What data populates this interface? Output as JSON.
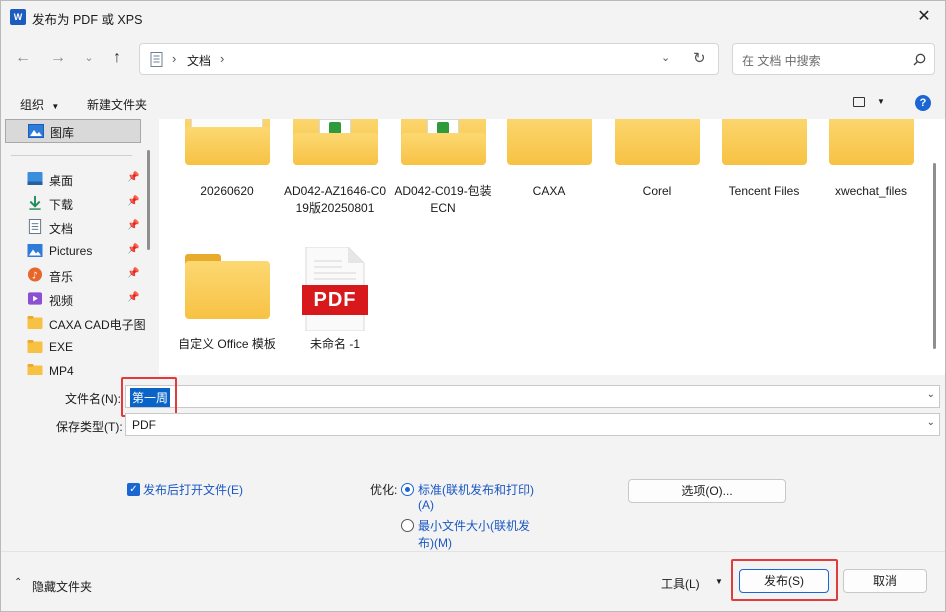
{
  "window": {
    "title": "发布为 PDF 或 XPS",
    "app_icon_letter": "W"
  },
  "address": {
    "path_root_icon": "document-icon",
    "path": [
      "文档"
    ],
    "search_placeholder": "在 文档 中搜索"
  },
  "toolbar": {
    "organize_label": "组织",
    "new_folder_label": "新建文件夹"
  },
  "sidebar": {
    "items": [
      {
        "label": "图库",
        "icon": "gallery-icon",
        "pinned": false
      },
      {
        "label": "桌面",
        "icon": "desktop-icon",
        "pinned": true
      },
      {
        "label": "下载",
        "icon": "download-icon",
        "pinned": true
      },
      {
        "label": "文档",
        "icon": "document-icon",
        "pinned": true
      },
      {
        "label": "Pictures",
        "icon": "pictures-icon",
        "pinned": true
      },
      {
        "label": "音乐",
        "icon": "music-icon",
        "pinned": true
      },
      {
        "label": "视频",
        "icon": "video-icon",
        "pinned": true
      },
      {
        "label": "CAXA CAD电子图",
        "icon": "folder-icon",
        "pinned": false
      },
      {
        "label": "EXE",
        "icon": "folder-icon",
        "pinned": false
      },
      {
        "label": "MP4",
        "icon": "folder-icon",
        "pinned": false
      }
    ]
  },
  "files": [
    {
      "name": "20260620",
      "type": "folder"
    },
    {
      "name": "AD042-AZ1646-C019版20250801",
      "type": "folder"
    },
    {
      "name": "AD042-C019-包装ECN",
      "type": "folder"
    },
    {
      "name": "CAXA",
      "type": "folder"
    },
    {
      "name": "Corel",
      "type": "folder"
    },
    {
      "name": "Tencent Files",
      "type": "folder"
    },
    {
      "name": "xwechat_files",
      "type": "folder"
    },
    {
      "name": "自定义 Office 模板",
      "type": "folder"
    },
    {
      "name": "未命名 -1",
      "type": "pdf",
      "badge": "PDF"
    }
  ],
  "form": {
    "filename_label": "文件名(N):",
    "filename_value": "第一周",
    "filetype_label": "保存类型(T):",
    "filetype_value": "PDF",
    "open_after_publish_label": "发布后打开文件(E)",
    "open_after_publish_checked": true,
    "optimize_label": "优化:",
    "optimize_standard_label": "标准(联机发布和打印)",
    "optimize_standard_suffix": "(A)",
    "optimize_minimum_label": "最小文件大小(联机发",
    "optimize_minimum_suffix": "布)(M)",
    "optimize_selected": "standard",
    "options_button": "选项(O)..."
  },
  "footer": {
    "hide_folders_label": "隐藏文件夹",
    "tools_label": "工具(L)",
    "publish_button": "发布(S)",
    "cancel_button": "取消"
  },
  "colors": {
    "accent": "#1a66d2",
    "highlight_box": "#e23b3b",
    "folder": "#f7c244"
  }
}
